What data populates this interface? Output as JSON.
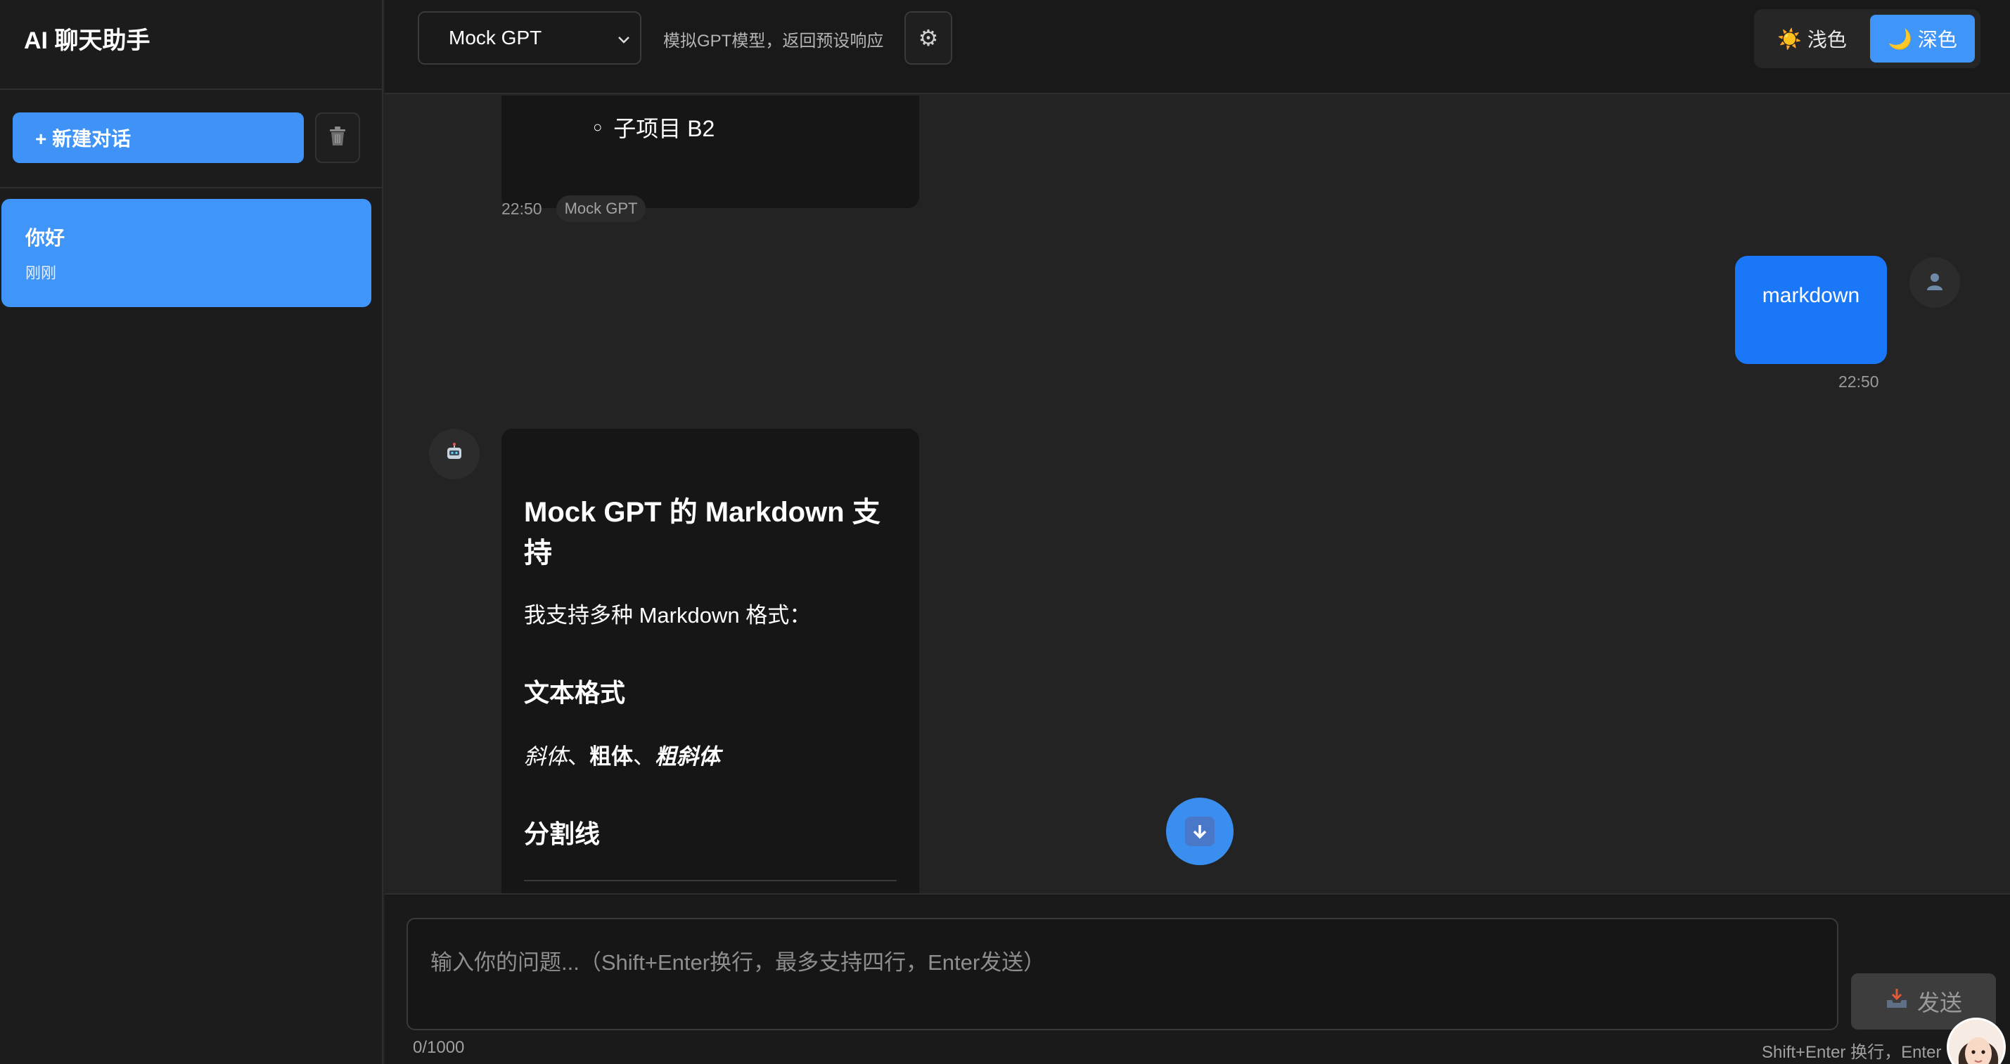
{
  "sidebar": {
    "title": "AI 聊天助手",
    "new_chat_label": "+ 新建对话",
    "conversations": [
      {
        "title": "你好",
        "time": "刚刚"
      }
    ]
  },
  "topbar": {
    "model_selected": "Mock GPT",
    "model_description": "模拟GPT模型，返回预设响应",
    "theme": {
      "light_label": "浅色",
      "dark_label": "深色",
      "active": "dark"
    }
  },
  "messages": [
    {
      "role": "assistant",
      "partial_content": "子项目 B2",
      "time": "22:50",
      "model_tag": "Mock GPT"
    },
    {
      "role": "user",
      "content": "markdown",
      "time": "22:50"
    },
    {
      "role": "assistant",
      "heading": "Mock GPT 的 Markdown 支持",
      "intro": "我支持多种 Markdown 格式：",
      "section1_heading": "文本格式",
      "format_italic": "斜体",
      "format_sep": "、",
      "format_bold": "粗体",
      "format_bold_italic": "粗斜体",
      "section2_heading": "分割线"
    }
  ],
  "input": {
    "placeholder": "输入你的问题...（Shift+Enter换行，最多支持四行，Enter发送）",
    "char_count": "0/1000",
    "send_label": "发送",
    "hint": "Shift+Enter 换行，Enter"
  },
  "icons": {
    "trash": "trash-icon",
    "settings": "gear-icon",
    "sun": "sun-icon",
    "moon": "moon-icon",
    "user_avatar": "user-icon",
    "bot_avatar": "robot-icon",
    "scroll_down": "arrow-down-icon",
    "send": "inbox-tray-icon"
  },
  "colors": {
    "accent": "#4095f8",
    "user_bubble": "#1a78f8",
    "background": "#232323"
  }
}
